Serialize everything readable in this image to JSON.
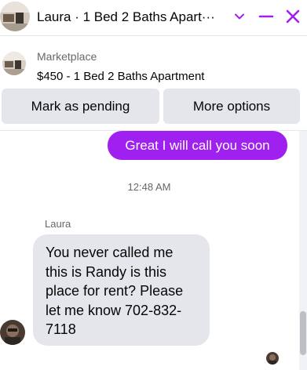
{
  "header": {
    "title": "Laura · 1 Bed 2 Baths Apart···",
    "avatar_icon": "listing-photo-avatar",
    "chevron_icon": "chevron-down-icon",
    "minimize_icon": "minimize-icon",
    "close_icon": "close-icon",
    "accent_color": "#a020f0"
  },
  "marketplace": {
    "label": "Marketplace",
    "listing": "$450 - 1 Bed 2 Baths Apartment"
  },
  "actions": {
    "pending_label": "Mark as pending",
    "more_label": "More options"
  },
  "messages": {
    "outgoing": "Great I will call you soon",
    "timestamp": "12:48 AM",
    "sender": "Laura",
    "incoming": "You never called me this is Randy is this place for rent? Please let me know 702-832-7118"
  }
}
